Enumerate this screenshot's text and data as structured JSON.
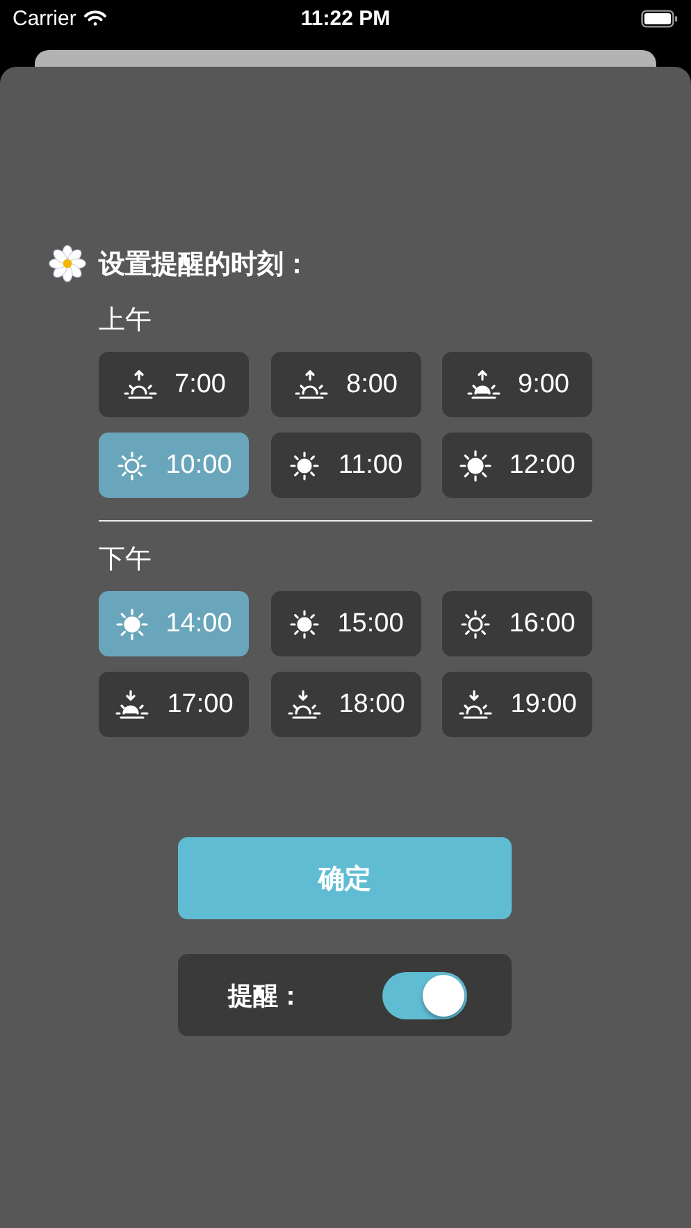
{
  "status_bar": {
    "carrier": "Carrier",
    "time": "11:22 PM"
  },
  "title": "设置提醒的时刻：",
  "sections": [
    {
      "label": "上午",
      "slots": [
        {
          "time": "7:00",
          "kind": "sunrise",
          "selected": false
        },
        {
          "time": "8:00",
          "kind": "sunrise",
          "selected": false
        },
        {
          "time": "9:00",
          "kind": "sunrise-full",
          "selected": false
        },
        {
          "time": "10:00",
          "kind": "sun-light",
          "selected": true
        },
        {
          "time": "11:00",
          "kind": "sun",
          "selected": false
        },
        {
          "time": "12:00",
          "kind": "sun-full",
          "selected": false
        }
      ]
    },
    {
      "label": "下午",
      "slots": [
        {
          "time": "14:00",
          "kind": "sun-full",
          "selected": true
        },
        {
          "time": "15:00",
          "kind": "sun",
          "selected": false
        },
        {
          "time": "16:00",
          "kind": "sun-light",
          "selected": false
        },
        {
          "time": "17:00",
          "kind": "sunset-full",
          "selected": false
        },
        {
          "time": "18:00",
          "kind": "sunset",
          "selected": false
        },
        {
          "time": "19:00",
          "kind": "sunset",
          "selected": false
        }
      ]
    }
  ],
  "confirm_button": "确定",
  "reminder": {
    "label": "提醒：",
    "on": true
  }
}
